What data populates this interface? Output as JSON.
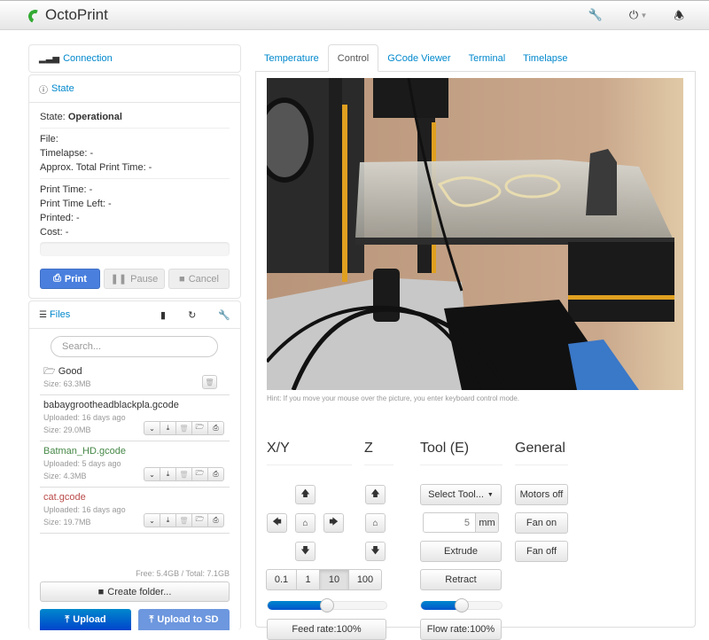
{
  "navbar": {
    "brand": "OctoPrint",
    "icons": [
      "wrench-icon",
      "power-icon",
      "bell-icon"
    ]
  },
  "sidebar": {
    "connection": {
      "label": "Connection"
    },
    "state": {
      "label": "State",
      "state_label": "State:",
      "state_value": "Operational",
      "file": "File:",
      "timelapse": "Timelapse: -",
      "approx_total": "Approx. Total Print Time: -",
      "print_time": "Print Time: -",
      "print_time_left": "Print Time Left: -",
      "printed": "Printed: -",
      "cost": "Cost: -",
      "progress": 0,
      "buttons": {
        "print": "Print",
        "pause": "Pause",
        "cancel": "Cancel"
      }
    },
    "files": {
      "label": "Files",
      "search_placeholder": "Search...",
      "items": [
        {
          "name": "Good",
          "type": "folder",
          "size": "Size: 63.3MB"
        },
        {
          "name": "babaygrootheadblackpla.gcode",
          "uploaded": "Uploaded: 16 days ago",
          "size": "Size: 29.0MB"
        },
        {
          "name": "Batman_HD.gcode",
          "uploaded": "Uploaded: 5 days ago",
          "size": "Size: 4.3MB"
        },
        {
          "name": "cat.gcode",
          "uploaded": "Uploaded: 16 days ago",
          "size": "Size: 19.7MB"
        }
      ],
      "storage": "Free: 5.4GB / Total: 7.1GB",
      "create_folder": "Create folder...",
      "upload": "Upload",
      "upload_sd": "Upload to SD"
    }
  },
  "tabs": [
    {
      "label": "Temperature"
    },
    {
      "label": "Control",
      "active": true
    },
    {
      "label": "GCode Viewer"
    },
    {
      "label": "Terminal"
    },
    {
      "label": "Timelapse"
    }
  ],
  "control": {
    "hint": "Hint: If you move your mouse over the picture, you enter keyboard control mode.",
    "xy_title": "X/Y",
    "z_title": "Z",
    "tool_title": "Tool (E)",
    "general_title": "General",
    "step_sizes": [
      "0.1",
      "1",
      "10",
      "100"
    ],
    "active_step": "10",
    "feed_rate_label": "Feed rate:100%",
    "feed_rate_slider": 0.5,
    "select_tool": "Select Tool...",
    "extrude_amount": "5",
    "extrude_unit": "mm",
    "extrude": "Extrude",
    "retract": "Retract",
    "flow_rate_label": "Flow rate:100%",
    "flow_rate_slider": 0.5,
    "motors_off": "Motors off",
    "fan_on": "Fan on",
    "fan_off": "Fan off"
  }
}
